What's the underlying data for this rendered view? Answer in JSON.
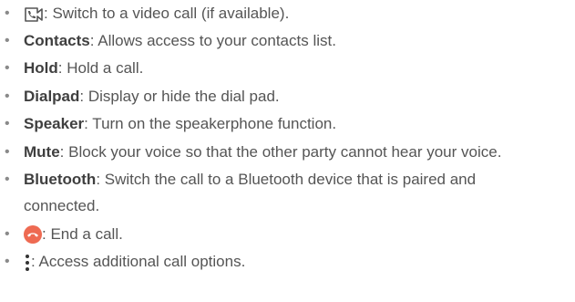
{
  "items": [
    {
      "icon": "video-call-icon",
      "text": ": Switch to a video call (if available)."
    },
    {
      "term": "Contacts",
      "text": ": Allows access to your contacts list."
    },
    {
      "term": "Hold",
      "text": ": Hold a call."
    },
    {
      "term": "Dialpad",
      "text": ": Display or hide the dial pad."
    },
    {
      "term": "Speaker",
      "text": ": Turn on the speakerphone function."
    },
    {
      "term": "Mute",
      "text": ": Block your voice so that the other party cannot hear your voice."
    },
    {
      "term": "Bluetooth",
      "text": ": Switch the call to a Bluetooth device that is paired and",
      "text2": "connected."
    },
    {
      "icon": "end-call-icon",
      "text": ": End a call."
    },
    {
      "icon": "more-options-icon",
      "text": ": Access additional call options."
    }
  ],
  "bullet": "•",
  "colors": {
    "end_call": "#ee6a52",
    "text": "#555555",
    "term": "#3f3f3f"
  }
}
